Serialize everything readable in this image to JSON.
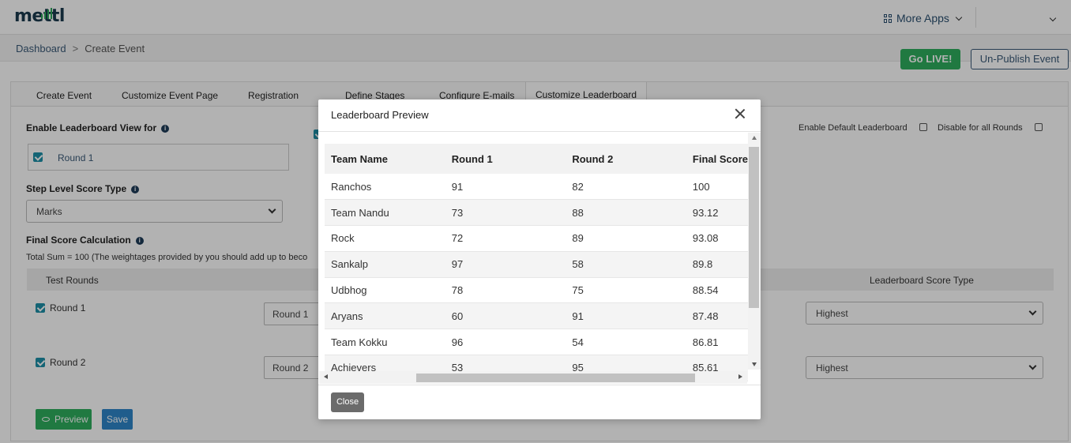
{
  "brand": {
    "logo_text": "mettl"
  },
  "header": {
    "more_apps_label": "More Apps"
  },
  "breadcrumb": {
    "home": "Dashboard",
    "separator": ">",
    "current": "Create Event"
  },
  "actions": {
    "go_live_label": "Go LIVE!",
    "unpublish_label": "Un-Publish Event"
  },
  "tabs": [
    {
      "label": "Create Event"
    },
    {
      "label": "Customize Event Page"
    },
    {
      "label": "Registration"
    },
    {
      "label": "Define Stages"
    },
    {
      "label": "Configure E-mails"
    },
    {
      "label": "Customize Leaderboard",
      "active": true
    }
  ],
  "leaderboard_settings": {
    "enable_view_label": "Enable Leaderboard View for",
    "round1_option": "Round 1",
    "enable_default_label": "Enable Default Leaderboard",
    "disable_all_label": "Disable for all Rounds",
    "step_score_label": "Step Level Score Type",
    "step_score_value": "Marks",
    "final_score_label": "Final Score Calculation",
    "total_sum_text": "Total Sum =  100  (The weightages provided by you should add up to beco",
    "col_test_rounds": "Test Rounds",
    "col_score_type": "Leaderboard Score Type",
    "rounds": [
      {
        "label": "Round 1",
        "input": "Round 1",
        "score_type": "Highest"
      },
      {
        "label": "Round 2",
        "input": "Round 2",
        "score_type": "Highest"
      }
    ],
    "preview_label": "Preview",
    "save_label": "Save"
  },
  "modal": {
    "title": "Leaderboard Preview",
    "columns": [
      "Team Name",
      "Round 1",
      "Round 2",
      "Final Score"
    ],
    "rows": [
      [
        "Ranchos",
        "91",
        "82",
        "100"
      ],
      [
        "Team Nandu",
        "73",
        "88",
        "93.12"
      ],
      [
        "Rock",
        "72",
        "89",
        "93.08"
      ],
      [
        "Sankalp",
        "97",
        "58",
        "89.8"
      ],
      [
        "Udbhog",
        "78",
        "75",
        "88.54"
      ],
      [
        "Aryans",
        "60",
        "91",
        "87.48"
      ],
      [
        "Team Kokku",
        "96",
        "54",
        "86.81"
      ],
      [
        "Achievers",
        "53",
        "95",
        "85.61"
      ]
    ],
    "close_label": "Close"
  }
}
